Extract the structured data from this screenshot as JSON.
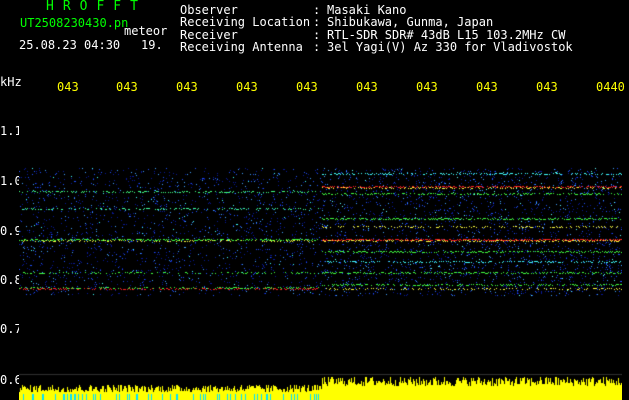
{
  "app": {
    "title": "HROFFT",
    "filename": "UT2508230430.pn",
    "meteor_label": "meteor",
    "datetime": "25.08.23 04:30",
    "count": "19."
  },
  "header": {
    "rows": [
      {
        "label": "Observer",
        "value": "Masaki Kano"
      },
      {
        "label": "Receiving Location",
        "value": "Shibukawa, Gunma, Japan"
      },
      {
        "label": "Receiver",
        "value": "RTL-SDR SDR# 43dB L15 103.2MHz CW"
      },
      {
        "label": "Receiving Antenna",
        "value": "3el Yagi(V) Az 330 for Vladivostok"
      }
    ],
    "separator": ":"
  },
  "axes": {
    "y_unit": "kHz",
    "y_ticks": [
      "1.1",
      "1.0",
      "0.9",
      "0.8",
      "0.7",
      "0.6"
    ],
    "time_ticks": [
      "043",
      "043",
      "043",
      "043",
      "043",
      "043",
      "043",
      "043",
      "043",
      "0440"
    ]
  },
  "colors": {
    "background": "#000000",
    "title_green": "#00ff00",
    "time_yellow": "#ffff00",
    "signal_red": "#ff2020",
    "signal_green": "#40ff40",
    "noise_blue": "#2040ff",
    "amplitude_yellow": "#ffff00",
    "amplitude_cyan": "#00e0ff"
  }
}
